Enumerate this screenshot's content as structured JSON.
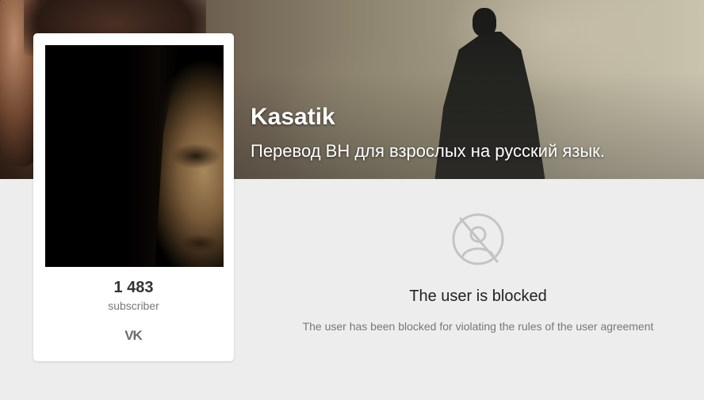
{
  "cover": {
    "title": "Kasatik",
    "subtitle": "Перевод ВН для взрослых на русский язык."
  },
  "profile": {
    "subscriber_count": "1 483",
    "subscriber_label": "subscriber",
    "social_icon": "vk-icon",
    "social_label": "VK"
  },
  "blocked": {
    "icon": "blocked-user-icon",
    "title": "The user is blocked",
    "description": "The user has been blocked for violating the rules of the user agreement"
  },
  "colors": {
    "page_background": "#ededed",
    "card_background": "#ffffff",
    "icon_gray": "#c4c4c4"
  }
}
